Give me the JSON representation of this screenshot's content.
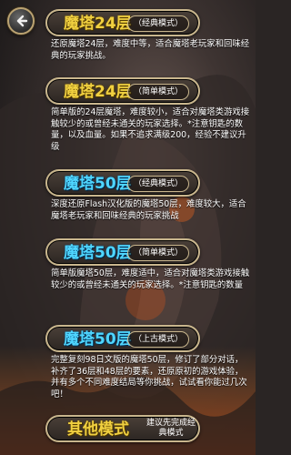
{
  "modes": [
    {
      "title": "魔塔24层",
      "tag": "（经典模式）",
      "desc": "还原魔塔24层，难度中等，适合魔塔老玩家和回味经典的玩家挑战。"
    },
    {
      "title": "魔塔24层",
      "tag": "（简单模式）",
      "desc": "简单版的24层魔塔，难度较小，适合对魔塔类游戏接触较少的或曾经未通关的玩家选择。*注意钥匙的数量，以及血量。如果不追求满级200，经验不建议升级"
    },
    {
      "title": "魔塔50层",
      "tag": "（经典模式）",
      "desc": "深度还原Flash汉化版的魔塔50层，难度较大，适合魔塔老玩家和回味经典的玩家挑战"
    },
    {
      "title": "魔塔50层",
      "tag": "（简单模式）",
      "desc": "简单版魔塔50层，难度适中，适合对魔塔类游戏接触较少的或曾经未通关的玩家选择。*注意钥匙的数量"
    },
    {
      "title": "魔塔50层",
      "tag": "（上古模式）",
      "desc": "完整复刻98日文版的魔塔50层，修订了部分对话，补齐了36层和48层的要素，还原原初的游戏体验，并有多个不同难度结局等你挑战，试试看你能过几次吧！"
    }
  ],
  "other": {
    "title": "其他模式",
    "note": "建议先完成经典模式"
  },
  "icons": {
    "back": "back-arrow-icon"
  },
  "colors": {
    "gold": "#f0d040",
    "cyan": "#4fd6ff",
    "border": "#c9b68d"
  }
}
